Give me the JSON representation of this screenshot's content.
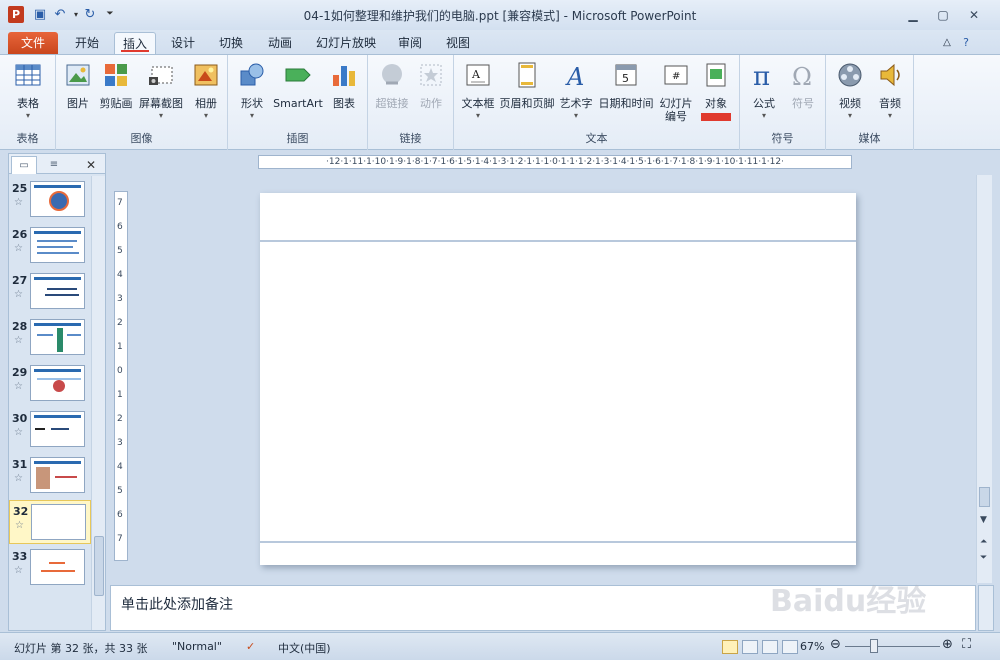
{
  "window": {
    "title": "04-1如何整理和维护我们的电脑.ppt [兼容模式] - Microsoft PowerPoint",
    "app_icon_letter": "P"
  },
  "tabs": [
    {
      "label": "文件"
    },
    {
      "label": "开始"
    },
    {
      "label": "插入"
    },
    {
      "label": "设计"
    },
    {
      "label": "切换"
    },
    {
      "label": "动画"
    },
    {
      "label": "幻灯片放映"
    },
    {
      "label": "审阅"
    },
    {
      "label": "视图"
    }
  ],
  "ribbon": {
    "groups": [
      {
        "label": "表格",
        "buttons": [
          {
            "label": "表格",
            "icon": "table-icon"
          }
        ]
      },
      {
        "label": "图像",
        "buttons": [
          {
            "label": "图片",
            "icon": "picture-icon"
          },
          {
            "label": "剪贴画",
            "icon": "clipart-icon"
          },
          {
            "label": "屏幕截图",
            "icon": "screenshot-icon"
          },
          {
            "label": "相册",
            "icon": "photo-album-icon"
          }
        ]
      },
      {
        "label": "插图",
        "buttons": [
          {
            "label": "形状",
            "icon": "shapes-icon"
          },
          {
            "label": "SmartArt",
            "icon": "smartart-icon"
          },
          {
            "label": "图表",
            "icon": "chart-icon"
          }
        ]
      },
      {
        "label": "链接",
        "buttons": [
          {
            "label": "超链接",
            "icon": "hyperlink-icon"
          },
          {
            "label": "动作",
            "icon": "action-icon"
          }
        ]
      },
      {
        "label": "文本",
        "buttons": [
          {
            "label": "文本框",
            "icon": "textbox-icon"
          },
          {
            "label": "页眉和页脚",
            "icon": "header-footer-icon"
          },
          {
            "label": "艺术字",
            "icon": "wordart-icon"
          },
          {
            "label": "日期和时间",
            "icon": "date-time-icon"
          },
          {
            "label": "幻灯片\n编号",
            "icon": "slide-number-icon"
          },
          {
            "label": "对象",
            "icon": "object-icon"
          }
        ]
      },
      {
        "label": "符号",
        "buttons": [
          {
            "label": "公式",
            "icon": "equation-icon"
          },
          {
            "label": "符号",
            "icon": "symbol-icon"
          }
        ]
      },
      {
        "label": "媒体",
        "buttons": [
          {
            "label": "视频",
            "icon": "video-icon"
          },
          {
            "label": "音频",
            "icon": "audio-icon"
          }
        ]
      }
    ]
  },
  "slides_panel": {
    "thumbnails": [
      {
        "number": "25"
      },
      {
        "number": "26"
      },
      {
        "number": "27"
      },
      {
        "number": "28"
      },
      {
        "number": "29"
      },
      {
        "number": "30"
      },
      {
        "number": "31"
      },
      {
        "number": "32"
      },
      {
        "number": "33"
      }
    ],
    "selected": "32",
    "star": "☆"
  },
  "ruler": {
    "horizontal": "·12·1·11·1·10·1·9·1·8·1·7·1·6·1·5·1·4·1·3·1·2·1·1·1·0·1·1·1·2·1·3·1·4·1·5·1·6·1·7·1·8·1·9·1·10·1·11·1·12·",
    "vertical_labels": [
      "7",
      "6",
      "5",
      "4",
      "3",
      "2",
      "1",
      "0",
      "1",
      "2",
      "3",
      "4",
      "5",
      "6",
      "7"
    ]
  },
  "notes": {
    "placeholder": "单击此处添加备注"
  },
  "status": {
    "slide_info": "幻灯片 第 32 张，共 33 张",
    "theme": "\"Normal\"",
    "language": "中文(中国)",
    "zoom": "67%"
  },
  "watermark": "Baidu经验",
  "colors": {
    "accent": "#e03a2e",
    "file_tab": "#c9461d",
    "ribbon_border": "#a9bfd6"
  }
}
